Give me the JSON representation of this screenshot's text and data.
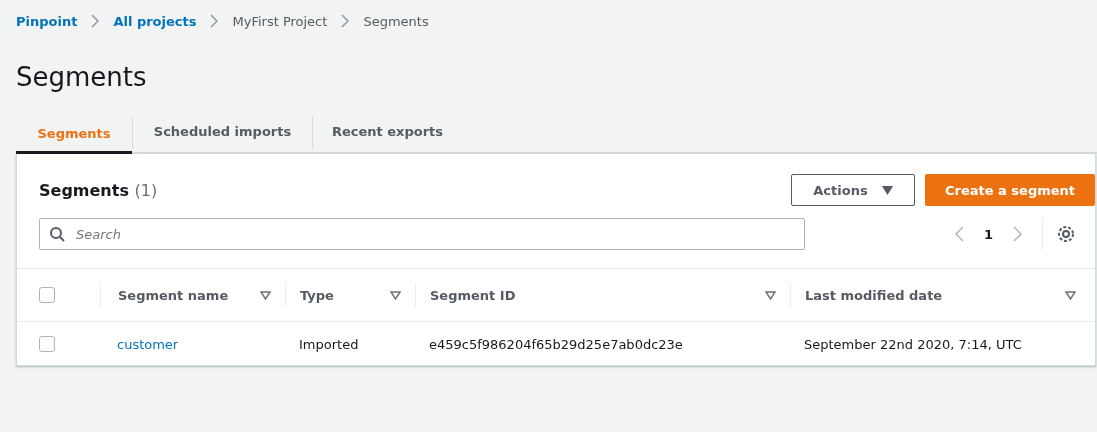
{
  "breadcrumb": [
    {
      "label": "Pinpoint",
      "kind": "link"
    },
    {
      "label": "All projects",
      "kind": "link"
    },
    {
      "label": "MyFirst Project",
      "kind": "text"
    },
    {
      "label": "Segments",
      "kind": "text"
    }
  ],
  "page_title": "Segments",
  "tabs": [
    {
      "label": "Segments",
      "selected": true
    },
    {
      "label": "Scheduled imports",
      "selected": false
    },
    {
      "label": "Recent exports",
      "selected": false
    }
  ],
  "panel": {
    "title": "Segments",
    "count": "(1)",
    "actions_button": "Actions",
    "create_button": "Create a segment",
    "search": {
      "placeholder": "Search"
    },
    "page": "1"
  },
  "table": {
    "select_all": {
      "checked": false
    },
    "columns": [
      "Segment name",
      "Type",
      "Segment ID",
      "Last modified date"
    ],
    "rows": [
      {
        "checked": false,
        "cells": [
          "customer",
          "Imported",
          "e459c5f986204f65b29d25e7ab0dc23e",
          "September 22nd 2020, 7:14, UTC"
        ]
      }
    ]
  }
}
